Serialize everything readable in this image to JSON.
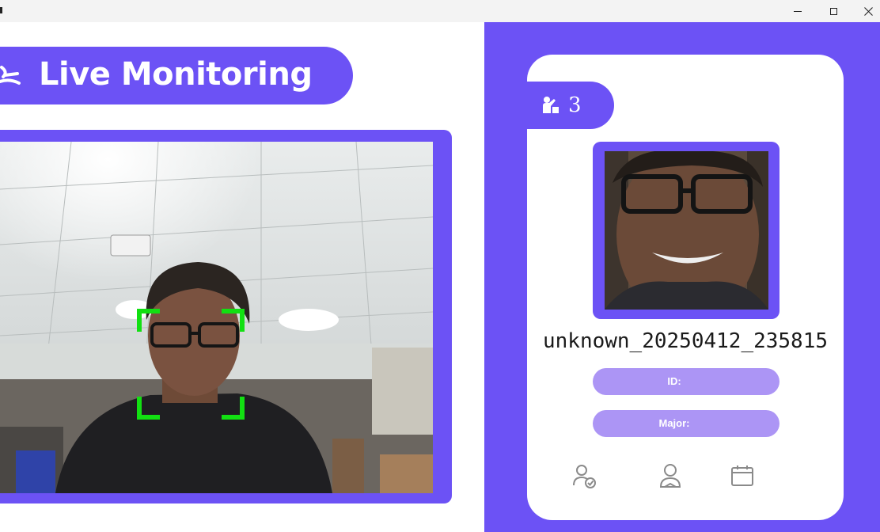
{
  "window": {
    "controls": [
      "minimize",
      "maximize",
      "close"
    ]
  },
  "header": {
    "title": "Live Monitoring",
    "icon": "wave-icon"
  },
  "camera": {
    "detection_box_color": "#12e012"
  },
  "panel": {
    "count": {
      "icon": "person-presenting-icon",
      "value": "3"
    },
    "person_name": "unknown_20250412_235815",
    "id_label": "ID:",
    "major_label": "Major:",
    "bottom_icons": [
      "attendance-check-icon",
      "student-icon",
      "calendar-icon"
    ]
  },
  "colors": {
    "accent": "#6c52f5",
    "field_pill": "#ac95f5",
    "card": "#ffffff"
  }
}
